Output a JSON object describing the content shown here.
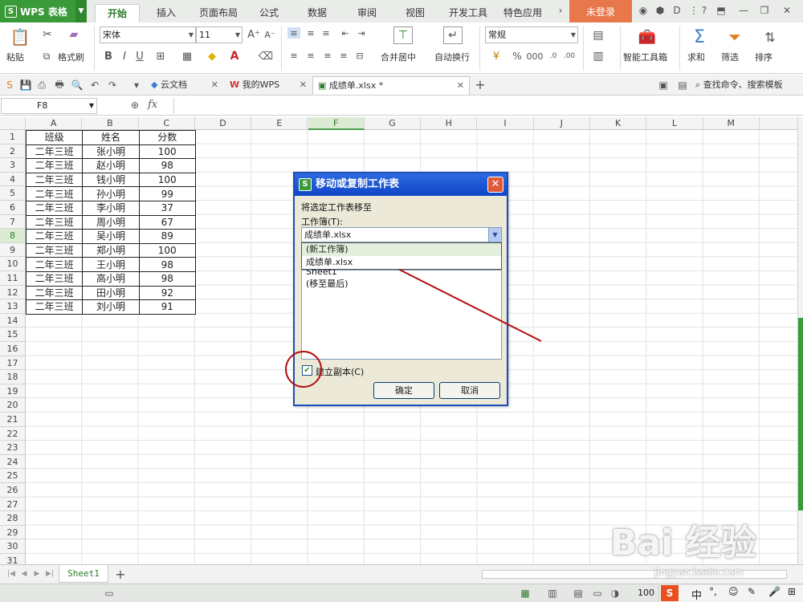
{
  "app": {
    "name": "WPS 表格",
    "login": "未登录"
  },
  "menu_tabs": [
    "开始",
    "插入",
    "页面布局",
    "公式",
    "数据",
    "审阅",
    "视图",
    "开发工具",
    "特色应用"
  ],
  "ribbon": {
    "paste": "粘贴",
    "format_painter": "格式刷",
    "font_name": "宋体",
    "font_size": "11",
    "bold": "B",
    "italic": "I",
    "underline": "U",
    "merge_center": "合并居中",
    "wrap_text": "自动换行",
    "number_format": "常规",
    "percent": "%",
    "smart_toolbox": "智能工具箱",
    "sum": "求和",
    "filter": "筛选",
    "sort": "排序"
  },
  "doc_tabs": [
    {
      "label": "云文档"
    },
    {
      "label": "我的WPS"
    },
    {
      "label": "成绩单.xlsx *"
    }
  ],
  "search_placeholder": "查找命令、搜索模板",
  "name_box": "F8",
  "fx": "fx",
  "columns": [
    "A",
    "B",
    "C",
    "D",
    "E",
    "F",
    "G",
    "H",
    "I",
    "J",
    "K",
    "L",
    "M"
  ],
  "rows": [
    "1",
    "2",
    "3",
    "4",
    "5",
    "6",
    "7",
    "8",
    "9",
    "10",
    "11",
    "12",
    "13",
    "14",
    "15",
    "16",
    "17",
    "18",
    "19",
    "20",
    "21",
    "22",
    "23",
    "24",
    "25",
    "26",
    "27",
    "28",
    "29",
    "30",
    "31"
  ],
  "table": {
    "headers": [
      "班级",
      "姓名",
      "分数"
    ],
    "rows": [
      [
        "二年三班",
        "张小明",
        "100"
      ],
      [
        "二年三班",
        "赵小明",
        "98"
      ],
      [
        "二年三班",
        "钱小明",
        "100"
      ],
      [
        "二年三班",
        "孙小明",
        "99"
      ],
      [
        "二年三班",
        "李小明",
        "37"
      ],
      [
        "二年三班",
        "周小明",
        "67"
      ],
      [
        "二年三班",
        "吴小明",
        "89"
      ],
      [
        "二年三班",
        "郑小明",
        "100"
      ],
      [
        "二年三班",
        "王小明",
        "98"
      ],
      [
        "二年三班",
        "高小明",
        "98"
      ],
      [
        "二年三班",
        "田小明",
        "92"
      ],
      [
        "二年三班",
        "刘小明",
        "91"
      ]
    ]
  },
  "sheet_tab": "Sheet1",
  "dialog": {
    "title": "移动或复制工作表",
    "move_to_label": "将选定工作表移至",
    "workbook_label": "工作簿(T):",
    "workbook_value": "成绩单.xlsx",
    "dropdown_options": [
      "(新工作簿)",
      "成绩单.xlsx"
    ],
    "sheet_partial": "Sheet1",
    "sheet_last": "(移至最后)",
    "copy_label": "建立副本(C)",
    "copy_checked": true,
    "ok": "确定",
    "cancel": "取消"
  },
  "status": {
    "zoom": "100"
  },
  "watermark": {
    "text": "Bai 经验",
    "url": "jingyan.baidu.com"
  }
}
